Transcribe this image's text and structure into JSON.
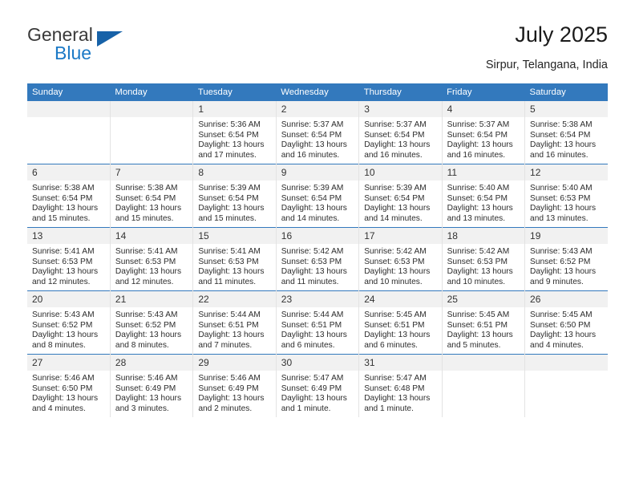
{
  "brand": {
    "name_part1": "General",
    "name_part2": "Blue",
    "flag_icon": "triangle-flag-icon",
    "color_dark": "#3a3a3a",
    "color_blue": "#1b79c6"
  },
  "header": {
    "title": "July 2025",
    "location": "Sirpur, Telangana, India"
  },
  "theme": {
    "header_band": "#3379bd",
    "daynum_band": "#f1f1f1",
    "row_divider": "#3379bd",
    "cell_divider": "#e3e3e3"
  },
  "labels": {
    "sunrise_prefix": "Sunrise:",
    "sunset_prefix": "Sunset:",
    "daylight_prefix": "Daylight:"
  },
  "weekday_headers": [
    "Sunday",
    "Monday",
    "Tuesday",
    "Wednesday",
    "Thursday",
    "Friday",
    "Saturday"
  ],
  "weeks": [
    [
      {
        "day": "",
        "empty": true
      },
      {
        "day": "",
        "empty": true
      },
      {
        "day": "1",
        "sunrise": "Sunrise: 5:36 AM",
        "sunset": "Sunset: 6:54 PM",
        "daylight": "Daylight: 13 hours and 17 minutes."
      },
      {
        "day": "2",
        "sunrise": "Sunrise: 5:37 AM",
        "sunset": "Sunset: 6:54 PM",
        "daylight": "Daylight: 13 hours and 16 minutes."
      },
      {
        "day": "3",
        "sunrise": "Sunrise: 5:37 AM",
        "sunset": "Sunset: 6:54 PM",
        "daylight": "Daylight: 13 hours and 16 minutes."
      },
      {
        "day": "4",
        "sunrise": "Sunrise: 5:37 AM",
        "sunset": "Sunset: 6:54 PM",
        "daylight": "Daylight: 13 hours and 16 minutes."
      },
      {
        "day": "5",
        "sunrise": "Sunrise: 5:38 AM",
        "sunset": "Sunset: 6:54 PM",
        "daylight": "Daylight: 13 hours and 16 minutes."
      }
    ],
    [
      {
        "day": "6",
        "sunrise": "Sunrise: 5:38 AM",
        "sunset": "Sunset: 6:54 PM",
        "daylight": "Daylight: 13 hours and 15 minutes."
      },
      {
        "day": "7",
        "sunrise": "Sunrise: 5:38 AM",
        "sunset": "Sunset: 6:54 PM",
        "daylight": "Daylight: 13 hours and 15 minutes."
      },
      {
        "day": "8",
        "sunrise": "Sunrise: 5:39 AM",
        "sunset": "Sunset: 6:54 PM",
        "daylight": "Daylight: 13 hours and 15 minutes."
      },
      {
        "day": "9",
        "sunrise": "Sunrise: 5:39 AM",
        "sunset": "Sunset: 6:54 PM",
        "daylight": "Daylight: 13 hours and 14 minutes."
      },
      {
        "day": "10",
        "sunrise": "Sunrise: 5:39 AM",
        "sunset": "Sunset: 6:54 PM",
        "daylight": "Daylight: 13 hours and 14 minutes."
      },
      {
        "day": "11",
        "sunrise": "Sunrise: 5:40 AM",
        "sunset": "Sunset: 6:54 PM",
        "daylight": "Daylight: 13 hours and 13 minutes."
      },
      {
        "day": "12",
        "sunrise": "Sunrise: 5:40 AM",
        "sunset": "Sunset: 6:53 PM",
        "daylight": "Daylight: 13 hours and 13 minutes."
      }
    ],
    [
      {
        "day": "13",
        "sunrise": "Sunrise: 5:41 AM",
        "sunset": "Sunset: 6:53 PM",
        "daylight": "Daylight: 13 hours and 12 minutes."
      },
      {
        "day": "14",
        "sunrise": "Sunrise: 5:41 AM",
        "sunset": "Sunset: 6:53 PM",
        "daylight": "Daylight: 13 hours and 12 minutes."
      },
      {
        "day": "15",
        "sunrise": "Sunrise: 5:41 AM",
        "sunset": "Sunset: 6:53 PM",
        "daylight": "Daylight: 13 hours and 11 minutes."
      },
      {
        "day": "16",
        "sunrise": "Sunrise: 5:42 AM",
        "sunset": "Sunset: 6:53 PM",
        "daylight": "Daylight: 13 hours and 11 minutes."
      },
      {
        "day": "17",
        "sunrise": "Sunrise: 5:42 AM",
        "sunset": "Sunset: 6:53 PM",
        "daylight": "Daylight: 13 hours and 10 minutes."
      },
      {
        "day": "18",
        "sunrise": "Sunrise: 5:42 AM",
        "sunset": "Sunset: 6:53 PM",
        "daylight": "Daylight: 13 hours and 10 minutes."
      },
      {
        "day": "19",
        "sunrise": "Sunrise: 5:43 AM",
        "sunset": "Sunset: 6:52 PM",
        "daylight": "Daylight: 13 hours and 9 minutes."
      }
    ],
    [
      {
        "day": "20",
        "sunrise": "Sunrise: 5:43 AM",
        "sunset": "Sunset: 6:52 PM",
        "daylight": "Daylight: 13 hours and 8 minutes."
      },
      {
        "day": "21",
        "sunrise": "Sunrise: 5:43 AM",
        "sunset": "Sunset: 6:52 PM",
        "daylight": "Daylight: 13 hours and 8 minutes."
      },
      {
        "day": "22",
        "sunrise": "Sunrise: 5:44 AM",
        "sunset": "Sunset: 6:51 PM",
        "daylight": "Daylight: 13 hours and 7 minutes."
      },
      {
        "day": "23",
        "sunrise": "Sunrise: 5:44 AM",
        "sunset": "Sunset: 6:51 PM",
        "daylight": "Daylight: 13 hours and 6 minutes."
      },
      {
        "day": "24",
        "sunrise": "Sunrise: 5:45 AM",
        "sunset": "Sunset: 6:51 PM",
        "daylight": "Daylight: 13 hours and 6 minutes."
      },
      {
        "day": "25",
        "sunrise": "Sunrise: 5:45 AM",
        "sunset": "Sunset: 6:51 PM",
        "daylight": "Daylight: 13 hours and 5 minutes."
      },
      {
        "day": "26",
        "sunrise": "Sunrise: 5:45 AM",
        "sunset": "Sunset: 6:50 PM",
        "daylight": "Daylight: 13 hours and 4 minutes."
      }
    ],
    [
      {
        "day": "27",
        "sunrise": "Sunrise: 5:46 AM",
        "sunset": "Sunset: 6:50 PM",
        "daylight": "Daylight: 13 hours and 4 minutes."
      },
      {
        "day": "28",
        "sunrise": "Sunrise: 5:46 AM",
        "sunset": "Sunset: 6:49 PM",
        "daylight": "Daylight: 13 hours and 3 minutes."
      },
      {
        "day": "29",
        "sunrise": "Sunrise: 5:46 AM",
        "sunset": "Sunset: 6:49 PM",
        "daylight": "Daylight: 13 hours and 2 minutes."
      },
      {
        "day": "30",
        "sunrise": "Sunrise: 5:47 AM",
        "sunset": "Sunset: 6:49 PM",
        "daylight": "Daylight: 13 hours and 1 minute."
      },
      {
        "day": "31",
        "sunrise": "Sunrise: 5:47 AM",
        "sunset": "Sunset: 6:48 PM",
        "daylight": "Daylight: 13 hours and 1 minute."
      },
      {
        "day": "",
        "empty": true
      },
      {
        "day": "",
        "empty": true
      }
    ]
  ]
}
